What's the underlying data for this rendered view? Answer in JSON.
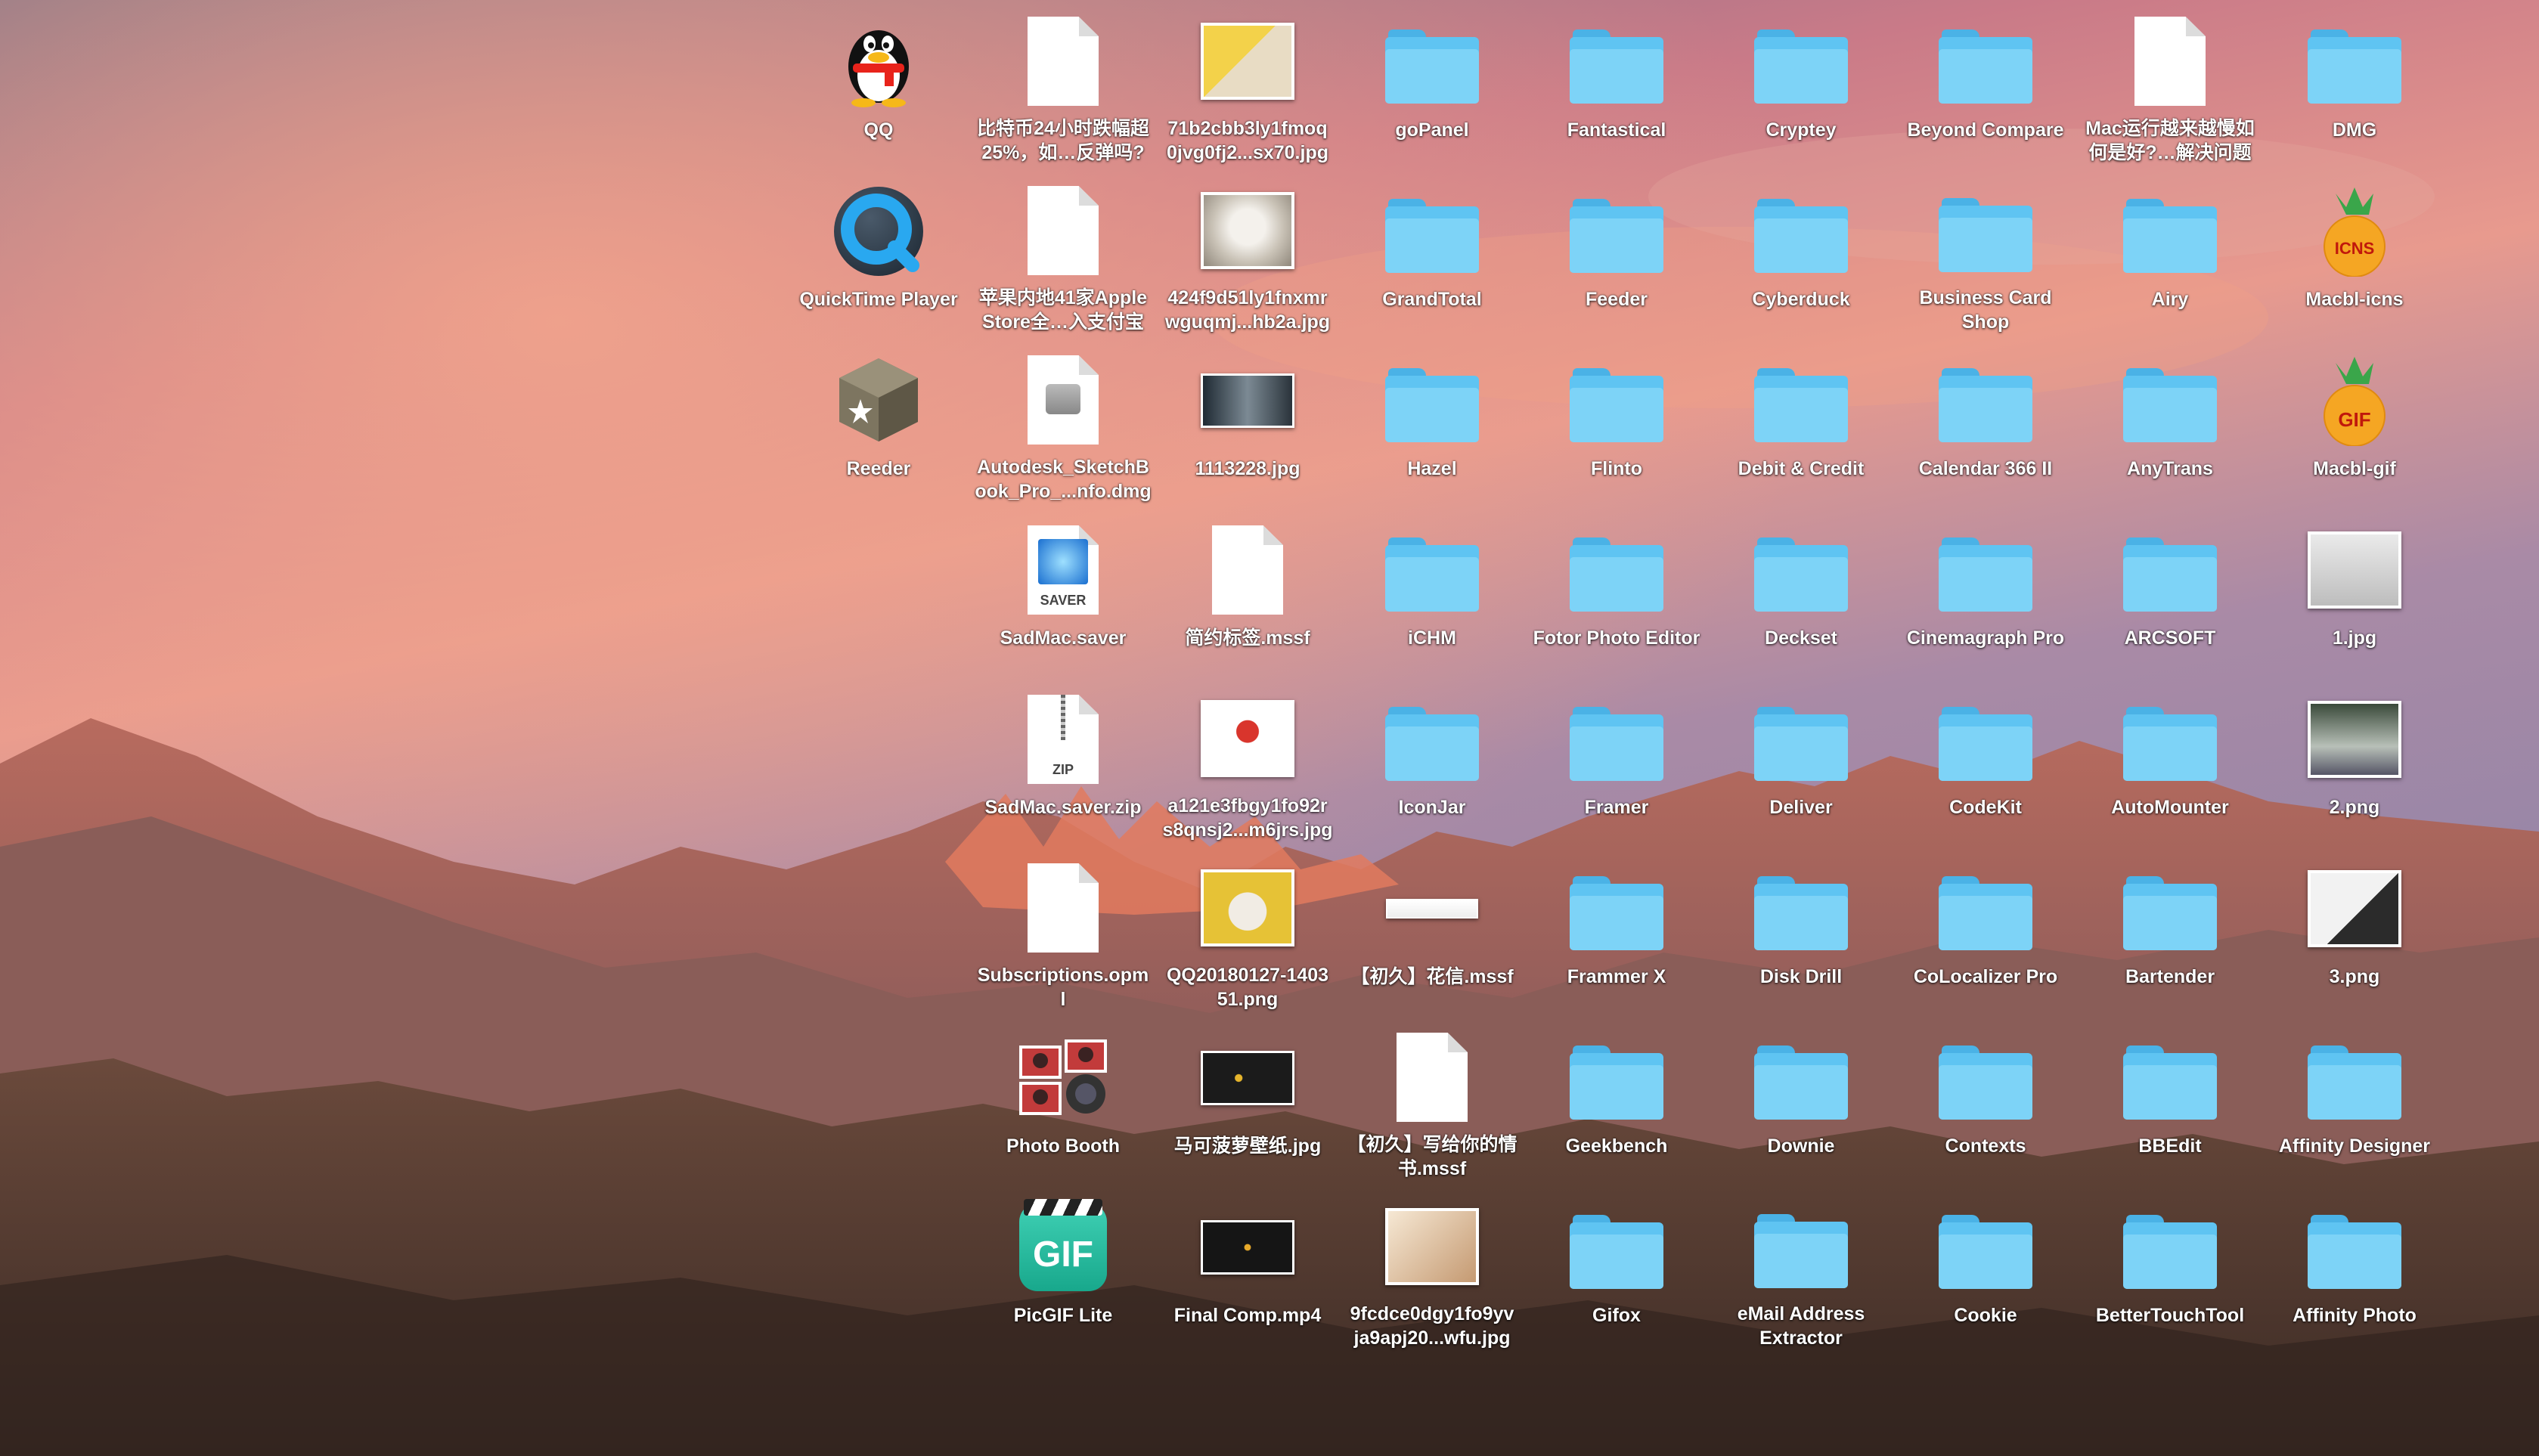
{
  "colors": {
    "folder_body": "#5fc4f2",
    "folder_lip": "#7dd3f7",
    "folder_tab": "#4ab2e6"
  },
  "desktop": {
    "columns": [
      {
        "items": [
          {
            "label": "QQ",
            "kind": "app-qq",
            "icon": "qq-penguin-icon"
          },
          {
            "label": "QuickTime Player",
            "kind": "app-quicktime",
            "icon": "quicktime-icon"
          },
          {
            "label": "Reeder",
            "kind": "app-reeder",
            "icon": "reeder-star-icon"
          }
        ]
      },
      {
        "items": [
          {
            "label": "比特币24小时跌幅超\n25%，如…反弹吗?",
            "kind": "doc",
            "icon": "document-icon"
          },
          {
            "label": "苹果内地41家Apple\nStore全…入支付宝",
            "kind": "doc",
            "icon": "document-icon"
          },
          {
            "label": "Autodesk_SketchB\nook_Pro_...nfo.dmg",
            "kind": "dmg",
            "icon": "disk-image-icon"
          },
          {
            "label": "SadMac.saver",
            "kind": "saver",
            "icon": "screensaver-icon",
            "badge": "SAVER"
          },
          {
            "label": "SadMac.saver.zip",
            "kind": "zip",
            "icon": "zip-archive-icon",
            "badge": "ZIP"
          },
          {
            "label": "Subscriptions.opm\nl",
            "kind": "doc",
            "icon": "document-icon"
          },
          {
            "label": "Photo Booth",
            "kind": "app-photobooth",
            "icon": "photo-booth-icon"
          },
          {
            "label": "PicGIF Lite",
            "kind": "app-picgif",
            "icon": "picgif-icon",
            "badge": "GIF"
          }
        ]
      },
      {
        "items": [
          {
            "label": "71b2cbb3ly1fmoq\n0jvg0fj2...sx70.jpg",
            "kind": "thumb-banana",
            "icon": "image-thumbnail-icon"
          },
          {
            "label": "424f9d51ly1fnxmr\nwguqmj...hb2a.jpg",
            "kind": "thumb-cat",
            "icon": "image-thumbnail-icon"
          },
          {
            "label": "1113228.jpg",
            "kind": "thumb-wide-dark",
            "icon": "image-thumbnail-icon"
          },
          {
            "label": "简约标签.mssf",
            "kind": "doc",
            "icon": "document-icon"
          },
          {
            "label": "a121e3fbgy1fo92r\ns8qnsj2...m6jrs.jpg",
            "kind": "thumb-cartoon",
            "icon": "image-thumbnail-icon"
          },
          {
            "label": "QQ20180127-1403\n51.png",
            "kind": "thumb-yellow",
            "icon": "image-thumbnail-icon"
          },
          {
            "label": "马可菠萝壁纸.jpg",
            "kind": "thumb-black",
            "icon": "image-thumbnail-icon"
          },
          {
            "label": "Final Comp.mp4",
            "kind": "thumb-video",
            "icon": "video-thumbnail-icon"
          }
        ]
      },
      {
        "items": [
          {
            "label": "goPanel",
            "kind": "folder",
            "icon": "folder-icon"
          },
          {
            "label": "GrandTotal",
            "kind": "folder",
            "icon": "folder-icon"
          },
          {
            "label": "Hazel",
            "kind": "folder",
            "icon": "folder-icon"
          },
          {
            "label": "iCHM",
            "kind": "folder",
            "icon": "folder-icon"
          },
          {
            "label": "IconJar",
            "kind": "folder",
            "icon": "folder-icon"
          },
          {
            "label": "【初久】花信.mssf",
            "kind": "thumb-strip",
            "icon": "image-thumbnail-icon"
          },
          {
            "label": "【初久】写给你的情\n书.mssf",
            "kind": "doc",
            "icon": "document-icon"
          },
          {
            "label": "9fcdce0dgy1fo9yv\nja9apj20...wfu.jpg",
            "kind": "thumb-person",
            "icon": "image-thumbnail-icon"
          }
        ]
      },
      {
        "items": [
          {
            "label": "Fantastical",
            "kind": "folder",
            "icon": "folder-icon"
          },
          {
            "label": "Feeder",
            "kind": "folder",
            "icon": "folder-icon"
          },
          {
            "label": "Flinto",
            "kind": "folder",
            "icon": "folder-icon"
          },
          {
            "label": "Fotor Photo Editor",
            "kind": "folder",
            "icon": "folder-icon"
          },
          {
            "label": "Framer",
            "kind": "folder",
            "icon": "folder-icon"
          },
          {
            "label": "Frammer X",
            "kind": "folder",
            "icon": "folder-icon"
          },
          {
            "label": "Geekbench",
            "kind": "folder",
            "icon": "folder-icon"
          },
          {
            "label": "Gifox",
            "kind": "folder",
            "icon": "folder-icon"
          }
        ]
      },
      {
        "items": [
          {
            "label": "Cryptey",
            "kind": "folder",
            "icon": "folder-icon"
          },
          {
            "label": "Cyberduck",
            "kind": "folder",
            "icon": "folder-icon"
          },
          {
            "label": "Debit & Credit",
            "kind": "folder",
            "icon": "folder-icon"
          },
          {
            "label": "Deckset",
            "kind": "folder",
            "icon": "folder-icon"
          },
          {
            "label": "Deliver",
            "kind": "folder",
            "icon": "folder-icon"
          },
          {
            "label": "Disk Drill",
            "kind": "folder",
            "icon": "folder-icon"
          },
          {
            "label": "Downie",
            "kind": "folder",
            "icon": "folder-icon"
          },
          {
            "label": "eMail Address\nExtractor",
            "kind": "folder",
            "icon": "folder-icon"
          }
        ]
      },
      {
        "items": [
          {
            "label": "Beyond Compare",
            "kind": "folder",
            "icon": "folder-icon"
          },
          {
            "label": "Business Card\nShop",
            "kind": "folder",
            "icon": "folder-icon"
          },
          {
            "label": "Calendar 366 II",
            "kind": "folder",
            "icon": "folder-icon"
          },
          {
            "label": "Cinemagraph Pro",
            "kind": "folder",
            "icon": "folder-icon"
          },
          {
            "label": "CodeKit",
            "kind": "folder",
            "icon": "folder-icon"
          },
          {
            "label": "CoLocalizer Pro",
            "kind": "folder",
            "icon": "folder-icon"
          },
          {
            "label": "Contexts",
            "kind": "folder",
            "icon": "folder-icon"
          },
          {
            "label": "Cookie",
            "kind": "folder",
            "icon": "folder-icon"
          }
        ]
      },
      {
        "items": [
          {
            "label": "Mac运行越来越慢如\n何是好?…解决问题",
            "kind": "doc",
            "icon": "document-icon"
          },
          {
            "label": "Airy",
            "kind": "folder",
            "icon": "folder-icon"
          },
          {
            "label": "AnyTrans",
            "kind": "folder",
            "icon": "folder-icon"
          },
          {
            "label": "ARCSOFT",
            "kind": "folder",
            "icon": "folder-icon"
          },
          {
            "label": "AutoMounter",
            "kind": "folder",
            "icon": "folder-icon"
          },
          {
            "label": "Bartender",
            "kind": "folder",
            "icon": "folder-icon"
          },
          {
            "label": "BBEdit",
            "kind": "folder",
            "icon": "folder-icon"
          },
          {
            "label": "BetterTouchTool",
            "kind": "folder",
            "icon": "folder-icon"
          }
        ]
      },
      {
        "items": [
          {
            "label": "DMG",
            "kind": "folder",
            "icon": "folder-icon"
          },
          {
            "label": "Macbl-icns",
            "kind": "app-pineapple",
            "icon": "pineapple-icns-icon",
            "badge": "ICNS"
          },
          {
            "label": "Macbl-gif",
            "kind": "app-pineapple",
            "icon": "pineapple-gif-icon",
            "badge": "GIF"
          },
          {
            "label": "1.jpg",
            "kind": "thumb-computer",
            "icon": "image-thumbnail-icon"
          },
          {
            "label": "2.png",
            "kind": "thumb-screen",
            "icon": "image-thumbnail-icon"
          },
          {
            "label": "3.png",
            "kind": "thumb-device",
            "icon": "image-thumbnail-icon"
          },
          {
            "label": "Affinity Designer",
            "kind": "folder",
            "icon": "folder-icon"
          },
          {
            "label": "Affinity Photo",
            "kind": "folder",
            "icon": "folder-icon"
          }
        ]
      }
    ]
  }
}
